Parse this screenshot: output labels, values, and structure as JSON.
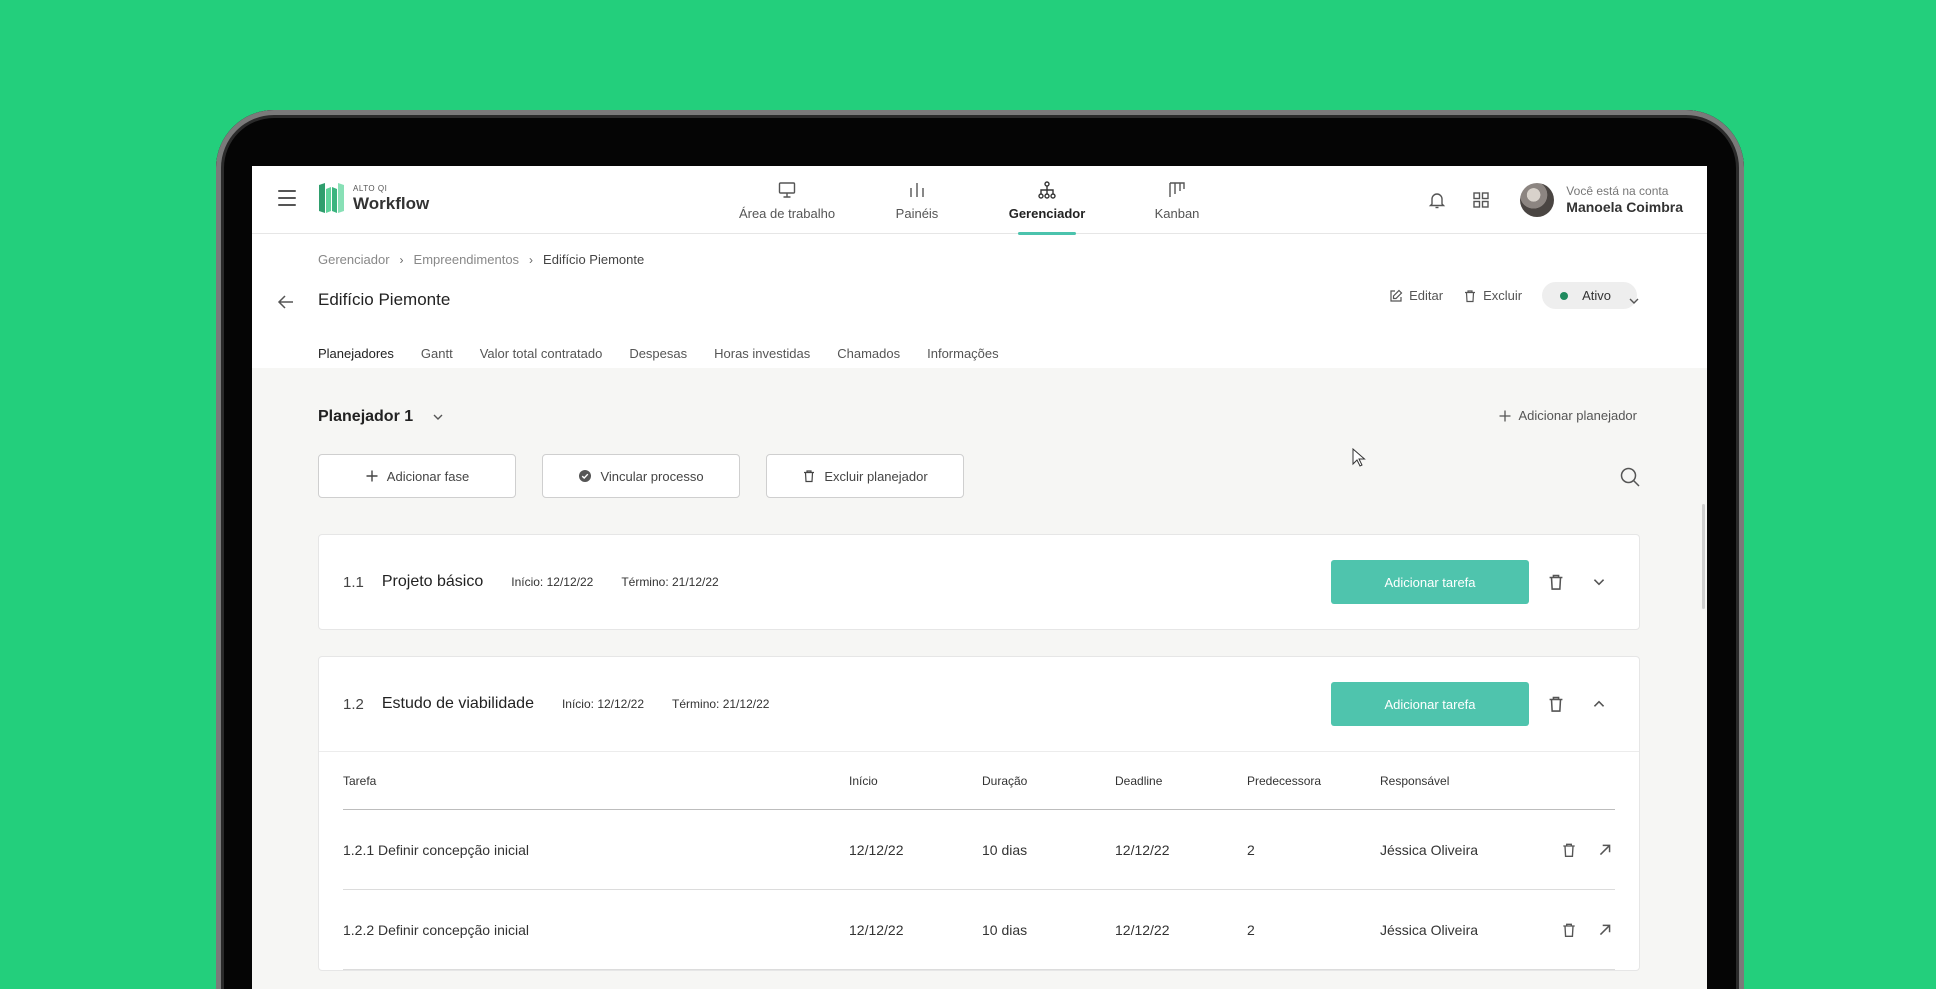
{
  "app": {
    "logo_small": "ALTO QI",
    "logo_name": "Workflow",
    "nav": [
      {
        "label": "Área de trabalho",
        "icon": "monitor-icon",
        "active": false
      },
      {
        "label": "Painéis",
        "icon": "panels-icon",
        "active": false
      },
      {
        "label": "Gerenciador",
        "icon": "hierarchy-icon",
        "active": true
      },
      {
        "label": "Kanban",
        "icon": "kanban-icon",
        "active": false
      }
    ],
    "user": {
      "caption": "Você está na conta",
      "name": "Manoela Coimbra"
    }
  },
  "breadcrumb": [
    "Gerenciador",
    "Empreendimentos",
    "Edifício Piemonte"
  ],
  "page": {
    "title": "Edifício Piemonte",
    "edit_label": "Editar",
    "delete_label": "Excluir",
    "status": "Ativo",
    "status_color": "#1f8a5e"
  },
  "tabs": [
    "Planejadores",
    "Gantt",
    "Valor total contratado",
    "Despesas",
    "Horas investidas",
    "Chamados",
    "Informações"
  ],
  "planner": {
    "title": "Planejador 1",
    "add_planner": "Adicionar planejador",
    "buttons": {
      "add_phase": "Adicionar fase",
      "link_process": "Vincular processo",
      "delete_planner": "Excluir planejador"
    }
  },
  "phases": [
    {
      "number": "1.1",
      "name": "Projeto básico",
      "start": "Início: 12/12/22",
      "end": "Término: 21/12/22",
      "add_task": "Adicionar tarefa"
    },
    {
      "number": "1.2",
      "name": "Estudo de viabilidade",
      "start": "Início: 12/12/22",
      "end": "Término: 21/12/22",
      "add_task": "Adicionar tarefa"
    }
  ],
  "task_table": {
    "headers": [
      "Tarefa",
      "Início",
      "Duração",
      "Deadline",
      "Predecessora",
      "Responsável"
    ],
    "rows": [
      {
        "task": "1.2.1 Definir concepção inicial",
        "start": "12/12/22",
        "duration": "10 dias",
        "deadline": "12/12/22",
        "predecessor": "2",
        "owner": "Jéssica Oliveira"
      },
      {
        "task": "1.2.2 Definir concepção inicial",
        "start": "12/12/22",
        "duration": "10 dias",
        "deadline": "12/12/22",
        "predecessor": "2",
        "owner": "Jéssica Oliveira"
      }
    ]
  },
  "colors": {
    "background": "#23cf7c",
    "accent": "#4fc4ad"
  }
}
